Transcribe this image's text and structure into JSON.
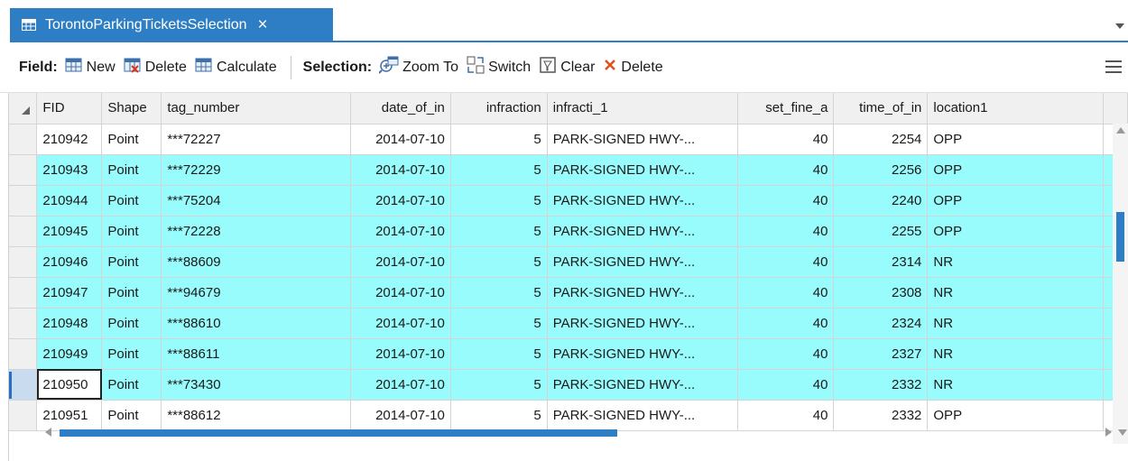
{
  "tab": {
    "title": "TorontoParkingTicketsSelection",
    "close_icon": "close-icon",
    "icon": "table-icon"
  },
  "toolbar": {
    "field_label": "Field:",
    "new_label": "New",
    "delete_label": "Delete",
    "calculate_label": "Calculate",
    "selection_label": "Selection:",
    "zoom_to_label": "Zoom To",
    "switch_label": "Switch",
    "clear_label": "Clear",
    "sel_delete_label": "Delete"
  },
  "colors": {
    "accent": "#2e7ec6",
    "selected_row": "#98fbfc",
    "delete_x": "#e0531f"
  },
  "table": {
    "headers": [
      "FID",
      "Shape",
      "tag_number",
      "date_of_in",
      "infraction",
      "infracti_1",
      "set_fine_a",
      "time_of_in",
      "location1"
    ],
    "rows": [
      [
        "210942",
        "Point",
        "***72227",
        "2014-07-10",
        "5",
        "PARK-SIGNED HWY-...",
        "40",
        "2254",
        "OPP"
      ],
      [
        "210943",
        "Point",
        "***72229",
        "2014-07-10",
        "5",
        "PARK-SIGNED HWY-...",
        "40",
        "2256",
        "OPP"
      ],
      [
        "210944",
        "Point",
        "***75204",
        "2014-07-10",
        "5",
        "PARK-SIGNED HWY-...",
        "40",
        "2240",
        "OPP"
      ],
      [
        "210945",
        "Point",
        "***72228",
        "2014-07-10",
        "5",
        "PARK-SIGNED HWY-...",
        "40",
        "2255",
        "OPP"
      ],
      [
        "210946",
        "Point",
        "***88609",
        "2014-07-10",
        "5",
        "PARK-SIGNED HWY-...",
        "40",
        "2314",
        "NR"
      ],
      [
        "210947",
        "Point",
        "***94679",
        "2014-07-10",
        "5",
        "PARK-SIGNED HWY-...",
        "40",
        "2308",
        "NR"
      ],
      [
        "210948",
        "Point",
        "***88610",
        "2014-07-10",
        "5",
        "PARK-SIGNED HWY-...",
        "40",
        "2324",
        "NR"
      ],
      [
        "210949",
        "Point",
        "***88611",
        "2014-07-10",
        "5",
        "PARK-SIGNED HWY-...",
        "40",
        "2327",
        "NR"
      ],
      [
        "210950",
        "Point",
        "***73430",
        "2014-07-10",
        "5",
        "PARK-SIGNED HWY-...",
        "40",
        "2332",
        "NR"
      ],
      [
        "210951",
        "Point",
        "***88612",
        "2014-07-10",
        "5",
        "PARK-SIGNED HWY-...",
        "40",
        "2332",
        "OPP"
      ]
    ],
    "selected_rows": [
      1,
      2,
      3,
      4,
      5,
      6,
      7,
      8
    ],
    "current_row": 8
  }
}
